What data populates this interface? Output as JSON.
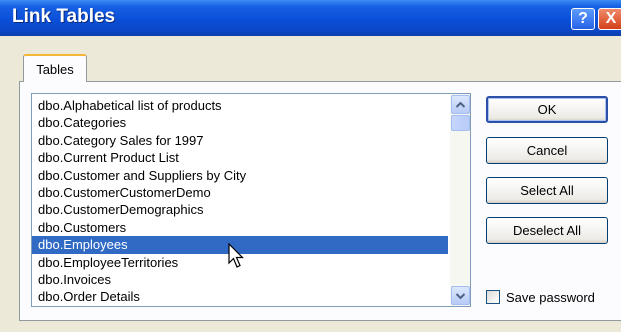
{
  "window": {
    "title": "Link Tables",
    "help_glyph": "?",
    "close_glyph": "X"
  },
  "tab": {
    "label": "Tables"
  },
  "tables_list": {
    "items": [
      "dbo.Alphabetical list of products",
      "dbo.Categories",
      "dbo.Category Sales for 1997",
      "dbo.Current Product List",
      "dbo.Customer and Suppliers by City",
      "dbo.CustomerCustomerDemo",
      "dbo.CustomerDemographics",
      "dbo.Customers",
      "dbo.Employees",
      "dbo.EmployeeTerritories",
      "dbo.Invoices",
      "dbo.Order Details"
    ],
    "selected_index": 8
  },
  "buttons": {
    "ok": "OK",
    "cancel": "Cancel",
    "select_all": "Select All",
    "deselect_all": "Deselect All"
  },
  "save_password": {
    "label": "Save password",
    "checked": false
  },
  "colors": {
    "title_bar": "#0a4fd8",
    "selection": "#316ac5",
    "dialog_bg": "#ece9d8"
  },
  "icons": {
    "scroll_up": "chevron-up-icon",
    "scroll_down": "chevron-down-icon",
    "cursor": "arrow-cursor-icon"
  }
}
